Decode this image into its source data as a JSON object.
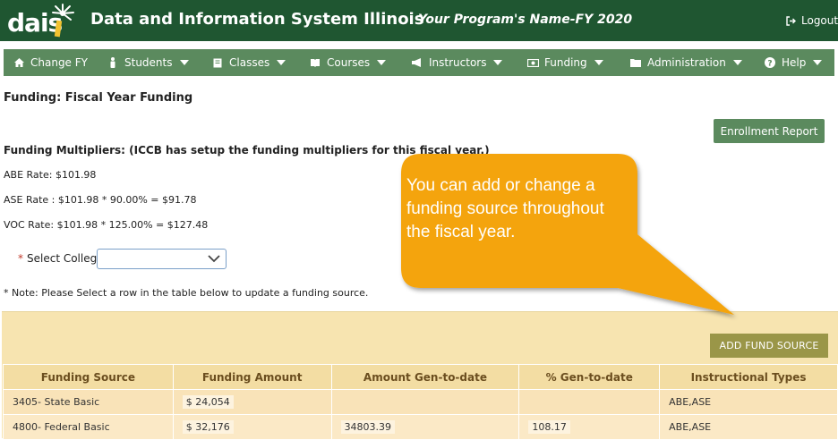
{
  "header": {
    "logo_text": "dais",
    "system_title": "Data and Information System Illinois",
    "program_name": "Your Program's Name-FY 2020",
    "logout_label": "Logout"
  },
  "nav": {
    "items": [
      {
        "label": "Change FY",
        "icon": "home-icon"
      },
      {
        "label": "Students",
        "icon": "person-icon"
      },
      {
        "label": "Classes",
        "icon": "book-icon"
      },
      {
        "label": "Courses",
        "icon": "open-book-icon"
      },
      {
        "label": "Instructors",
        "icon": "megaphone-icon"
      },
      {
        "label": "Funding",
        "icon": "money-icon"
      },
      {
        "label": "Administration",
        "icon": "folder-icon"
      },
      {
        "label": "Help",
        "icon": "question-icon"
      }
    ]
  },
  "page": {
    "title": "Funding: Fiscal Year Funding",
    "enrollment_report_label": "Enrollment Report",
    "multipliers_title": "Funding Multipliers: (ICCB has setup the funding multipliers for this fiscal year.)",
    "abe_rate": "ABE Rate: $101.98",
    "ase_rate": "ASE Rate : $101.98 * 90.00% = $91.78",
    "voc_rate": "VOC Rate: $101.98 * 125.00% = $127.48",
    "select_college_label": "Select College",
    "required_mark": "*",
    "select_college_value": "",
    "note": "* Note: Please Select a row in the table below to update a funding source."
  },
  "table": {
    "add_button_label": "ADD FUND SOURCE",
    "columns": [
      "Funding Source",
      "Funding Amount",
      "Amount Gen-to-date",
      "% Gen-to-date",
      "Instructional Types"
    ],
    "rows": [
      [
        "3405- State Basic",
        "$ 24,054",
        "",
        "",
        "ABE,ASE"
      ],
      [
        "4800- Federal Basic",
        "$ 32,176",
        "34803.39",
        "108.17",
        "ABE,ASE"
      ]
    ]
  },
  "callout": {
    "text": "You can add or change a funding source throughout the fiscal year.",
    "color": "#f4a40e"
  },
  "colors": {
    "header_bg": "#1f5631",
    "nav_bg": "#5b8a5e",
    "panel_bg": "#f7e4b0",
    "add_button_bg": "#9a9648"
  }
}
